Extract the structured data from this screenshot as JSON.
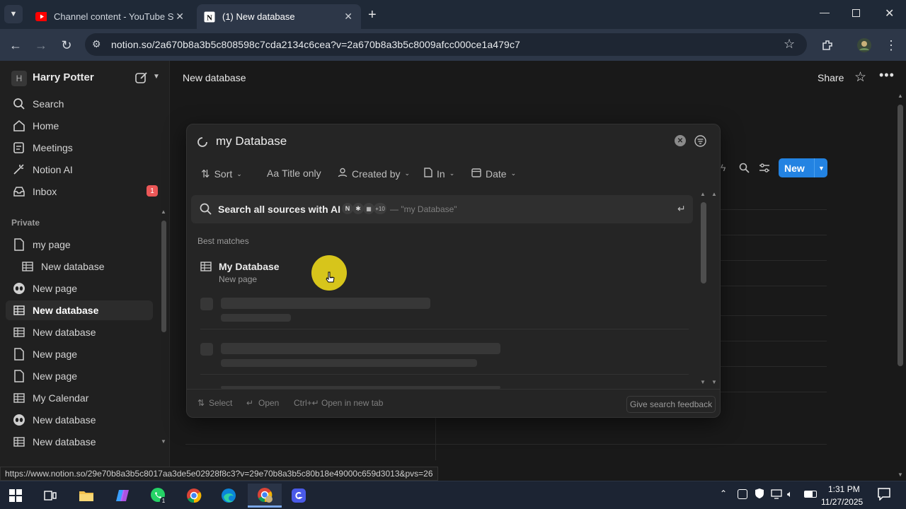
{
  "browser": {
    "tabs": [
      {
        "label": "Channel content - YouTube Stu"
      },
      {
        "label": "(1) New database"
      }
    ],
    "url": "notion.so/2a670b8a3b5c808598c7cda2134c6cea?v=2a670b8a3b5c8009afcc000ce1a479c7",
    "status_url": "https://www.notion.so/29e70b8a3b5c8017aa3de5e02928f8c3?v=29e70b8a3b5c80b18e49000c659d3013&pvs=26"
  },
  "sidebar": {
    "workspace_initial": "H",
    "workspace_name": "Harry Potter",
    "top_items": [
      {
        "label": "Search"
      },
      {
        "label": "Home"
      },
      {
        "label": "Meetings"
      },
      {
        "label": "Notion AI"
      },
      {
        "label": "Inbox",
        "badge": "1"
      }
    ],
    "private_label": "Private",
    "pages": [
      {
        "label": "my page"
      },
      {
        "label": "New database"
      },
      {
        "label": "New page"
      },
      {
        "label": "New database"
      },
      {
        "label": "New database"
      },
      {
        "label": "New page"
      },
      {
        "label": "New page"
      },
      {
        "label": "My Calendar"
      },
      {
        "label": "New database"
      },
      {
        "label": "New database"
      }
    ]
  },
  "header": {
    "title": "New database",
    "share_label": "Share"
  },
  "db_toolbar": {
    "new_label": "New"
  },
  "search": {
    "query": "my Database",
    "filters": {
      "sort": "Sort",
      "title_only": "Title only",
      "created_by": "Created by",
      "in": "In",
      "date": "Date"
    },
    "ai_label": "Search all sources with AI",
    "ai_more": "+10",
    "ai_query": "— \"my Database\"",
    "section_label": "Best matches",
    "result_title": "My Database",
    "result_sub": "New page",
    "footer": {
      "select": "Select",
      "open": "Open",
      "ctrl": "Ctrl+↵",
      "open_new_tab": "Open in new tab",
      "feedback": "Give search feedback"
    }
  },
  "taskbar": {
    "time": "1:31 PM",
    "date": "11/27/2025"
  },
  "colors": {
    "accent": "#2383e2",
    "badge": "#eb5757",
    "cursor_highlight": "#e6d21a"
  }
}
